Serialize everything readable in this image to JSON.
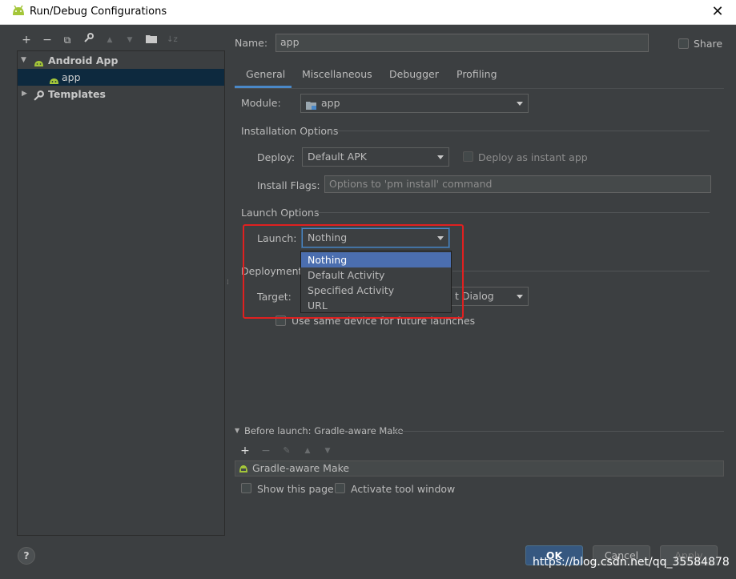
{
  "window": {
    "title": "Run/Debug Configurations",
    "close": "✕"
  },
  "toolbar": {
    "add": "+",
    "remove": "−",
    "copy": "⧉",
    "edit": "🔧",
    "up": "▲",
    "down": "▼",
    "folder": "▪",
    "sort": "↓z"
  },
  "tree": {
    "android_app": "Android App",
    "app": "app",
    "templates": "Templates"
  },
  "name": {
    "label": "Name:",
    "value": "app"
  },
  "share": {
    "label": "Share"
  },
  "tabs": [
    "General",
    "Miscellaneous",
    "Debugger",
    "Profiling"
  ],
  "module": {
    "label": "Module:",
    "value": "app"
  },
  "installation": {
    "header": "Installation Options",
    "deploy_label": "Deploy:",
    "deploy_value": "Default APK",
    "instant_label": "Deploy as instant app",
    "flags_label": "Install Flags:",
    "flags_placeholder": "Options to 'pm install' command"
  },
  "launch": {
    "header": "Launch Options",
    "label": "Launch:",
    "value": "Nothing",
    "options": [
      "Nothing",
      "Default Activity",
      "Specified Activity",
      "URL"
    ]
  },
  "deployment": {
    "header": "Deployment T",
    "target_label": "Target:",
    "target_value": "t Dialog",
    "same_device": "Use same device for future launches"
  },
  "before_launch": {
    "header": "Before launch: Gradle-aware Make",
    "item": "Gradle-aware Make",
    "show_page": "Show this page",
    "activate": "Activate tool window"
  },
  "buttons": {
    "ok": "OK",
    "cancel": "Cancel",
    "apply": "Apply",
    "help": "?"
  },
  "watermark": "https://blog.csdn.net/qq_35584878",
  "colors": {
    "accent": "#4a88c7",
    "selection": "#4b6eaf",
    "highlight_box": "#e02020",
    "android_green": "#a4c639"
  }
}
